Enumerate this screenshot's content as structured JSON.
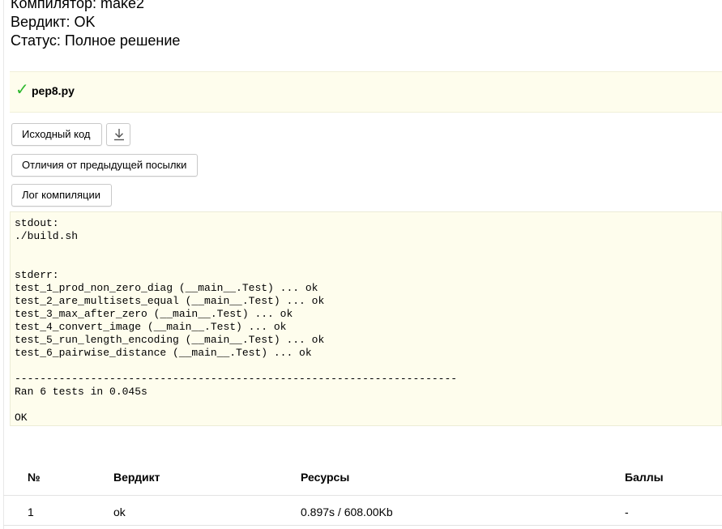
{
  "submission": {
    "compiler": "Компилятор: make2",
    "verdict": "Вердикт: OK",
    "status": "Статус: Полное решение"
  },
  "file": {
    "status_icon": "check-icon",
    "check_glyph": "✓",
    "name": "pep8.py"
  },
  "buttons": {
    "source": "Исходный код",
    "download_icon": "download-icon",
    "diff": "Отличия от предыдущей посылки",
    "log": "Лог компиляции"
  },
  "compile_log": "stdout:\n./build.sh\n\n\nstderr:\ntest_1_prod_non_zero_diag (__main__.Test) ... ok\ntest_2_are_multisets_equal (__main__.Test) ... ok\ntest_3_max_after_zero (__main__.Test) ... ok\ntest_4_convert_image (__main__.Test) ... ok\ntest_5_run_length_encoding (__main__.Test) ... ok\ntest_6_pairwise_distance (__main__.Test) ... ok\n\n----------------------------------------------------------------------\nRan 6 tests in 0.045s\n\nOK",
  "results_table": {
    "headers": [
      "№",
      "Вердикт",
      "Ресурсы",
      "Баллы"
    ],
    "rows": [
      [
        "1",
        "ok",
        "0.897s / 608.00Kb",
        "-"
      ]
    ]
  },
  "colors": {
    "panel_bg": "#fefded",
    "check": "#2eb82e"
  }
}
